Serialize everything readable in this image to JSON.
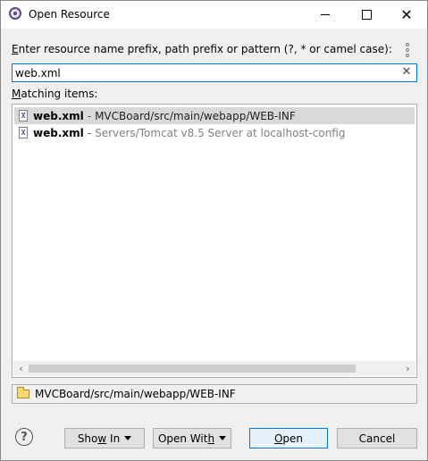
{
  "window": {
    "title": "Open Resource"
  },
  "prompt": {
    "label_accel": "E",
    "label_rest": "nter resource name prefix, path prefix or pattern (?, * or camel case):"
  },
  "search": {
    "value": "web.xml"
  },
  "matches": {
    "label_accel": "M",
    "label_rest": "atching items:",
    "items": [
      {
        "name": "web.xml",
        "separator": "-",
        "path": "MVCBoard/src/main/webapp/WEB-INF",
        "icon": "xml-file-icon"
      },
      {
        "name": "web.xml",
        "separator": "-",
        "path": "Servers/Tomcat v8.5 Server at localhost-config",
        "icon": "xml-file-icon"
      }
    ]
  },
  "location": {
    "text": "MVCBoard/src/main/webapp/WEB-INF",
    "icon": "folder-open-icon"
  },
  "buttons": {
    "show_in_pre": "Sho",
    "show_in_accel": "w",
    "show_in_post": " In",
    "open_with_pre": "Open Wit",
    "open_with_accel": "h",
    "open_pre": "",
    "open_accel": "O",
    "open_post": "pen",
    "cancel": "Cancel"
  },
  "colors": {
    "accent": "#0078d7",
    "selection": "#d9d9d9",
    "dim_path": "#808080"
  }
}
